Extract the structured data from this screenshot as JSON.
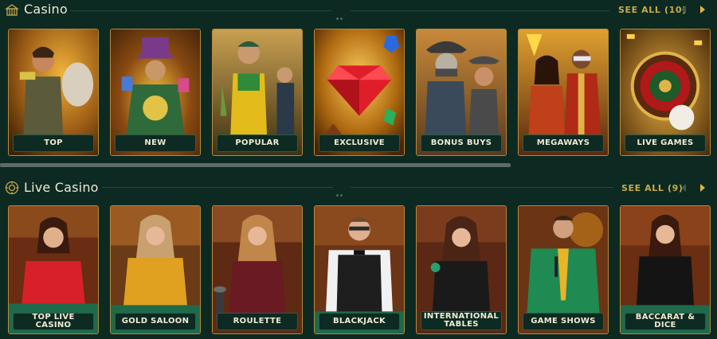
{
  "casino": {
    "title": "Casino",
    "see_all": "SEE ALL (10)",
    "icon": "casino-building-icon",
    "categories": [
      {
        "label": "TOP",
        "bg": "#7a4a12"
      },
      {
        "label": "NEW",
        "bg": "#6b4a14"
      },
      {
        "label": "POPULAR",
        "bg": "#5b4616"
      },
      {
        "label": "EXCLUSIVE",
        "bg": "#8a4f10"
      },
      {
        "label": "BONUS BUYS",
        "bg": "#6e5430"
      },
      {
        "label": "MEGAWAYS",
        "bg": "#7a3a14"
      },
      {
        "label": "LIVE GAMES",
        "bg": "#8a5a18"
      }
    ]
  },
  "live_casino": {
    "title": "Live Casino",
    "see_all": "SEE ALL (9)",
    "icon": "live-chip-icon",
    "categories": [
      {
        "label": "TOP LIVE CASINO",
        "bg": "#6a2c12"
      },
      {
        "label": "GOLD SALOON",
        "bg": "#6b3a16"
      },
      {
        "label": "ROULETTE",
        "bg": "#5e2a14"
      },
      {
        "label": "BLACKJACK",
        "bg": "#6a3416"
      },
      {
        "label": "INTERNATIONAL TABLES",
        "bg": "#5a2814"
      },
      {
        "label": "GAME SHOWS",
        "bg": "#6b3414"
      },
      {
        "label": "BACCARAT & DICE",
        "bg": "#6a2e12"
      }
    ]
  },
  "colors": {
    "accent_gold": "#c9a94d",
    "background": "#0c2a22"
  }
}
